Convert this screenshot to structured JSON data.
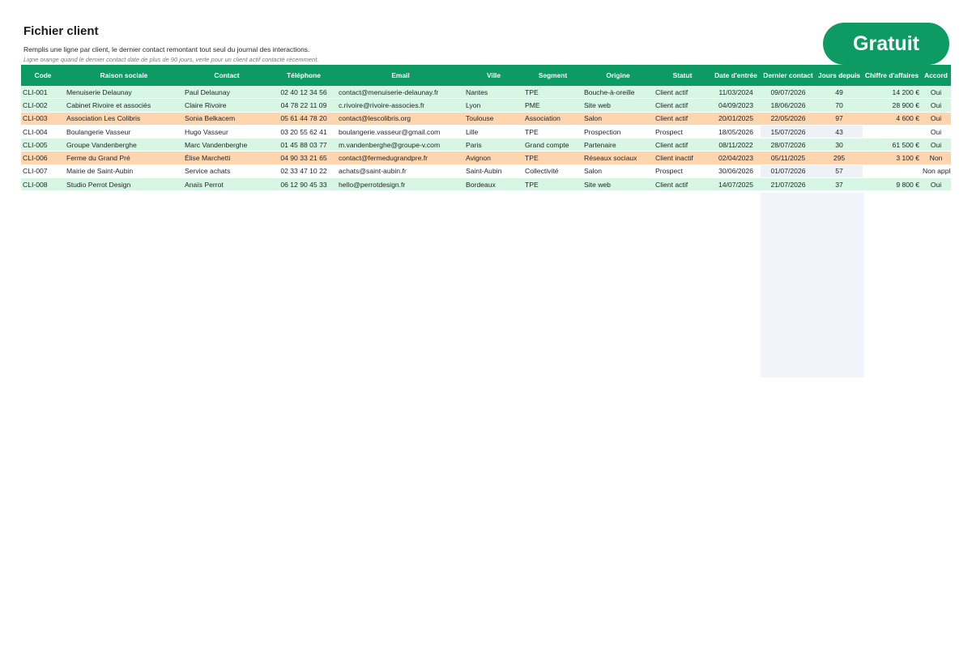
{
  "header": {
    "title": "Fichier client",
    "subtitle": "Remplis une ligne par client, le dernier contact remontant tout seul du journal des interactions.",
    "legend": "Ligne orange quand le dernier contact date de plus de 90 jours, verte pour un client actif contacté récemment."
  },
  "badge": {
    "label": "Gratuit"
  },
  "colors": {
    "header_green": "#0e9a63",
    "row_green": "#d7f6e3",
    "row_orange": "#fdd6b0",
    "empty_cell": "#eef2f6"
  },
  "table": {
    "columns": [
      "Code",
      "Raison sociale",
      "Contact",
      "Téléphone",
      "Email",
      "Ville",
      "Segment",
      "Origine",
      "Statut",
      "Date d'entrée",
      "Dernier contact",
      "Jours depuis",
      "Chiffre d'affaires",
      "Accord"
    ],
    "rows": [
      {
        "status": "green",
        "cells": [
          "CLI-001",
          "Menuiserie Delaunay",
          "Paul Delaunay",
          "02 40 12 34 56",
          "contact@menuiserie-delaunay.fr",
          "Nantes",
          "TPE",
          "Bouche-à-oreille",
          "Client actif",
          "11/03/2024",
          "09/07/2026",
          "49",
          "14 200 €",
          "Oui"
        ]
      },
      {
        "status": "green",
        "cells": [
          "CLI-002",
          "Cabinet Rivoire et associés",
          "Claire Rivoire",
          "04 78 22 11 09",
          "c.rivoire@rivoire-associes.fr",
          "Lyon",
          "PME",
          "Site web",
          "Client actif",
          "04/09/2023",
          "18/06/2026",
          "70",
          "28 900 €",
          "Oui"
        ]
      },
      {
        "status": "orange",
        "cells": [
          "CLI-003",
          "Association Les Colibris",
          "Sonia Belkacem",
          "05 61 44 78 20",
          "contact@lescolibris.org",
          "Toulouse",
          "Association",
          "Salon",
          "Client actif",
          "20/01/2025",
          "22/05/2026",
          "97",
          "4 600 €",
          "Oui"
        ]
      },
      {
        "status": "white",
        "cells": [
          "CLI-004",
          "Boulangerie Vasseur",
          "Hugo Vasseur",
          "03 20 55 62 41",
          "boulangerie.vasseur@gmail.com",
          "Lille",
          "TPE",
          "Prospection",
          "Prospect",
          "18/05/2026",
          "15/07/2026",
          "43",
          "",
          "Oui"
        ]
      },
      {
        "status": "green",
        "cells": [
          "CLI-005",
          "Groupe Vandenberghe",
          "Marc Vandenberghe",
          "01 45 88 03 77",
          "m.vandenberghe@groupe-v.com",
          "Paris",
          "Grand compte",
          "Partenaire",
          "Client actif",
          "08/11/2022",
          "28/07/2026",
          "30",
          "61 500 €",
          "Oui"
        ]
      },
      {
        "status": "orange",
        "cells": [
          "CLI-006",
          "Ferme du Grand Pré",
          "Élise Marchetti",
          "04 90 33 21 65",
          "contact@fermedugrandpre.fr",
          "Avignon",
          "TPE",
          "Réseaux sociaux",
          "Client inactif",
          "02/04/2023",
          "05/11/2025",
          "295",
          "3 100 €",
          "Non"
        ]
      },
      {
        "status": "white",
        "cells": [
          "CLI-007",
          "Mairie de Saint-Aubin",
          "Service achats",
          "02 33 47 10 22",
          "achats@saint-aubin.fr",
          "Saint-Aubin",
          "Collectivité",
          "Salon",
          "Prospect",
          "30/06/2026",
          "01/07/2026",
          "57",
          "",
          "Non applicable"
        ]
      },
      {
        "status": "green",
        "cells": [
          "CLI-008",
          "Studio Perrot Design",
          "Anaïs Perrot",
          "06 12 90 45 33",
          "hello@perrotdesign.fr",
          "Bordeaux",
          "TPE",
          "Site web",
          "Client actif",
          "14/07/2025",
          "21/07/2026",
          "37",
          "9 800 €",
          "Oui"
        ]
      }
    ]
  }
}
